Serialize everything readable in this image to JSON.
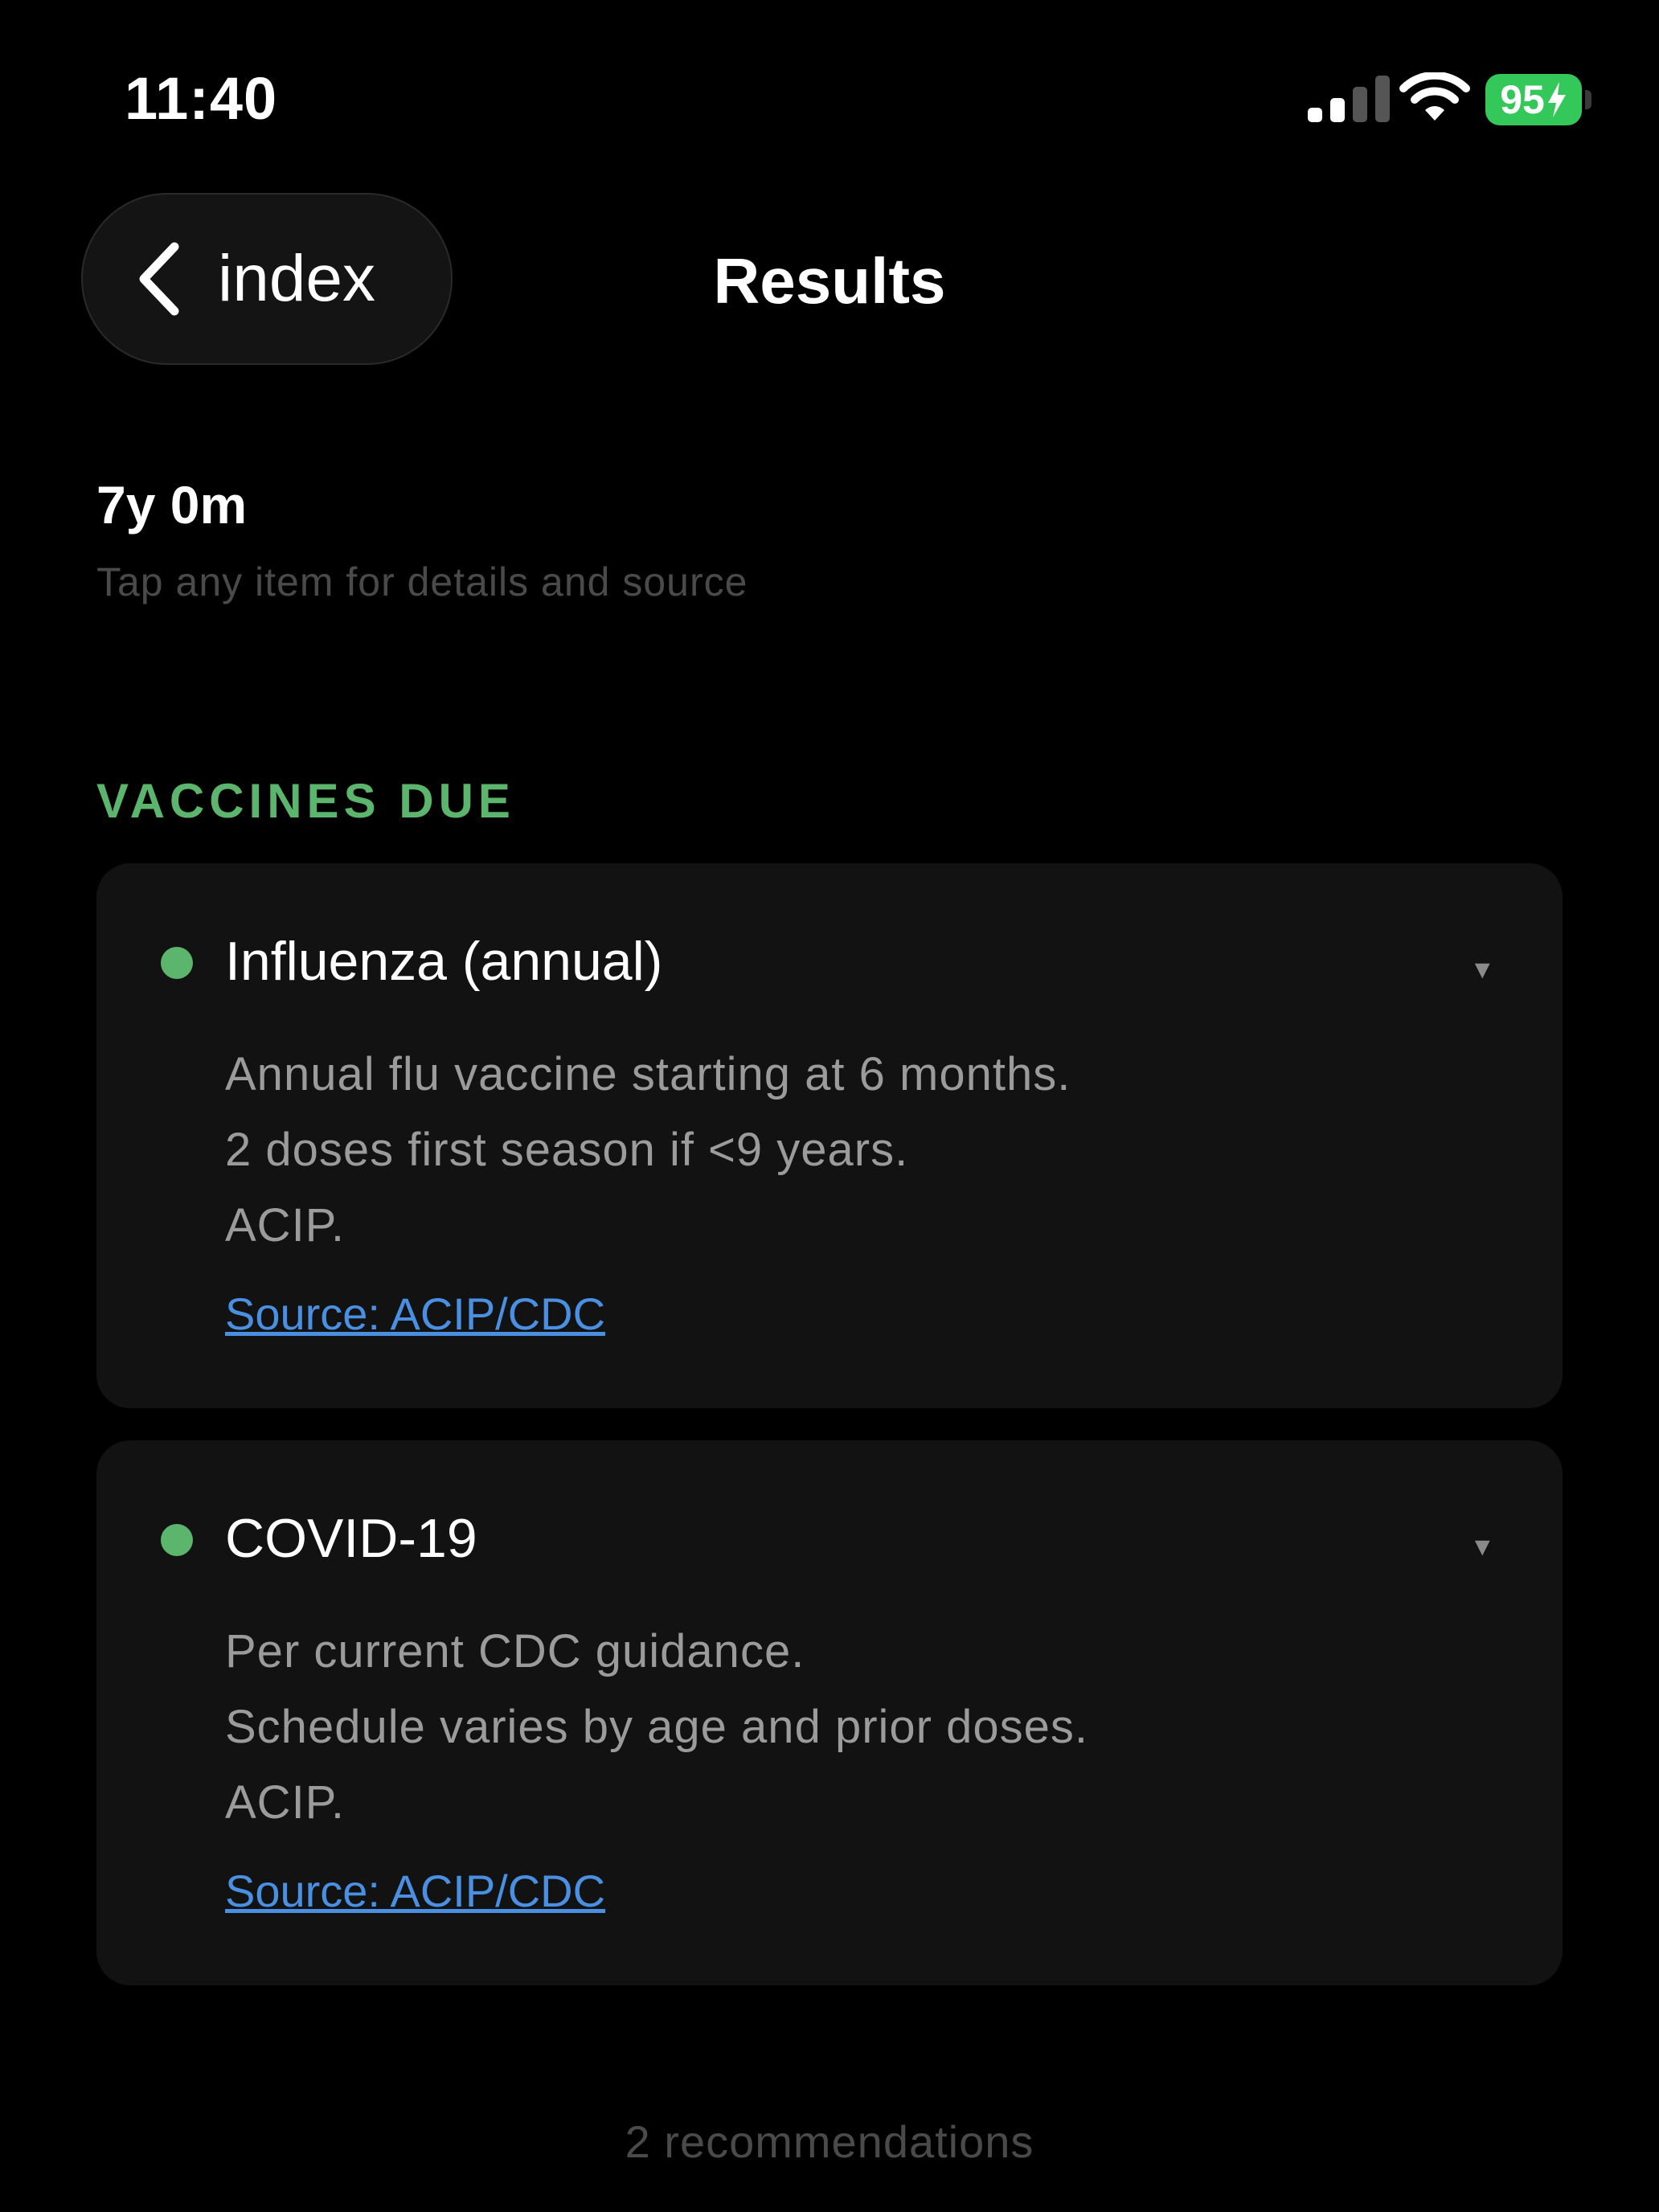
{
  "status_bar": {
    "time": "11:40",
    "battery_level": "95",
    "icons": [
      "signal-icon",
      "wifi-icon",
      "battery-charging-icon"
    ]
  },
  "nav": {
    "back_label": "index",
    "title": "Results"
  },
  "header": {
    "age": "7y 0m",
    "hint": "Tap any item for details and source"
  },
  "section": {
    "title": "VACCINES DUE"
  },
  "cards": [
    {
      "title": "Influenza (annual)",
      "lines": [
        "Annual flu vaccine starting at 6 months.",
        "2 doses first season if <9 years.",
        "ACIP."
      ],
      "source": "Source: ACIP/CDC",
      "expand_glyph": "▼"
    },
    {
      "title": "COVID-19",
      "lines": [
        "Per current CDC guidance.",
        "Schedule varies by age and prior doses.",
        "ACIP."
      ],
      "source": "Source: ACIP/CDC",
      "expand_glyph": "▼"
    }
  ],
  "footer": {
    "count": "2 recommendations"
  },
  "colors": {
    "background": "#000000",
    "card": "#121212",
    "accent_green": "#5cb56d",
    "link_blue": "#4a90e2",
    "battery_green": "#34c759"
  }
}
